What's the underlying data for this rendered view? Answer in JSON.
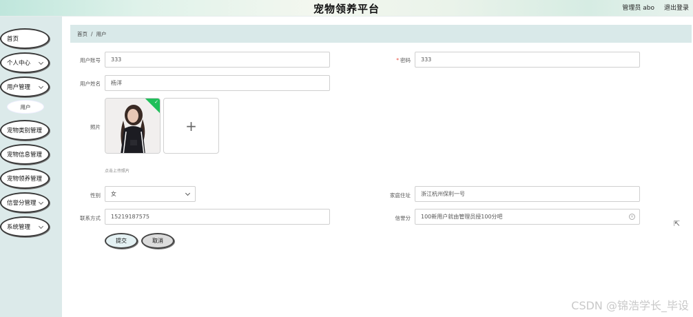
{
  "header": {
    "title": "宠物领养平台",
    "user": "管理员 abo",
    "logout": "退出登录"
  },
  "sidebar": {
    "items": [
      {
        "label": "首页"
      },
      {
        "label": "个人中心"
      },
      {
        "label": "用户管理"
      },
      {
        "label": "宠物类别管理"
      },
      {
        "label": "宠物信息管理"
      },
      {
        "label": "宠物领养管理"
      },
      {
        "label": "信誉分管理"
      },
      {
        "label": "系统管理"
      }
    ],
    "sub_item": "用户"
  },
  "breadcrumb": {
    "home": "首页",
    "sep": "/",
    "current": "用户"
  },
  "form": {
    "account_label": "用户账号",
    "account_value": "333",
    "password_req": "*",
    "password_label": "密码",
    "password_value": "333",
    "name_label": "用户姓名",
    "name_value": "杨洋",
    "photo_label": "照片",
    "upload_plus": "+",
    "upload_hint": "点击上传照片",
    "gender_label": "性别",
    "gender_value": "女",
    "address_label": "家庭住址",
    "address_value": "浙江杭州保利一号",
    "phone_label": "联系方式",
    "phone_value": "15219187575",
    "credit_label": "信誉分",
    "credit_value": "100新用户就由管理员授100分吧",
    "submit_label": "提交",
    "cancel_label": "取消"
  },
  "watermark": "CSDN @锦浩学长_毕设",
  "colors": {
    "sidebar_bg": "#dceaea",
    "crumb_bg": "#d9e9e9",
    "badge": "#1fbf5a"
  }
}
